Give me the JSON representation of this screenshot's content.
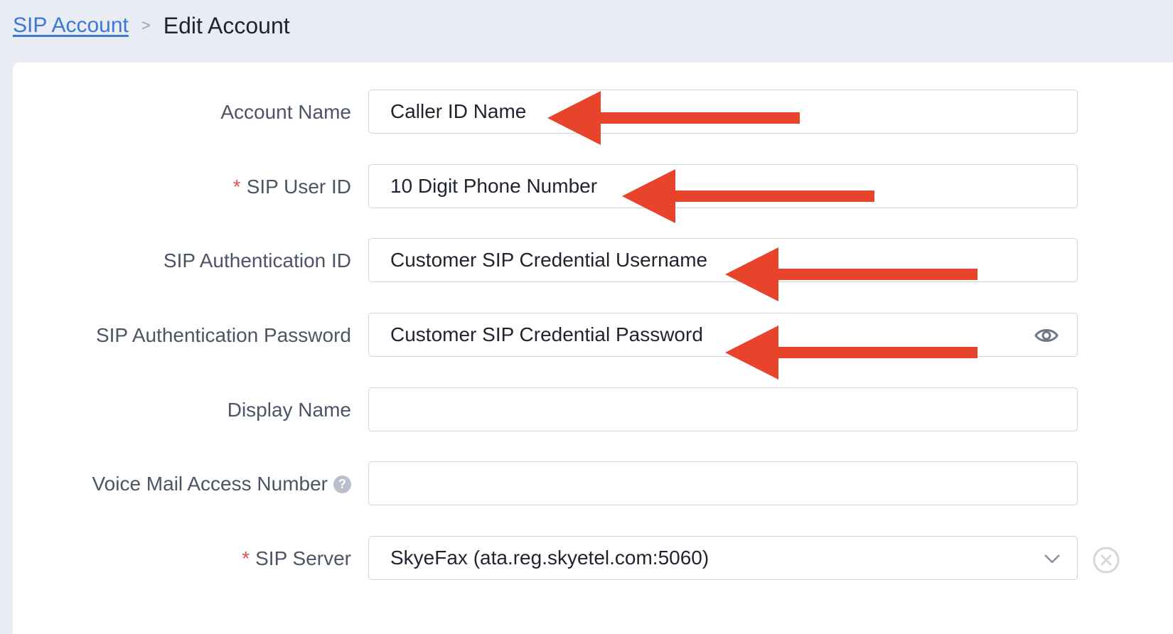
{
  "breadcrumb": {
    "parent": "SIP Account",
    "separator": ">",
    "current": "Edit Account"
  },
  "form": {
    "account_name": {
      "label": "Account Name",
      "value": "Caller ID Name"
    },
    "sip_user_id": {
      "required_mark": "*",
      "label": "SIP User ID",
      "value": "10 Digit Phone Number"
    },
    "sip_auth_id": {
      "label": "SIP Authentication ID",
      "value": "Customer SIP Credential Username"
    },
    "sip_auth_password": {
      "label": "SIP Authentication Password",
      "value": "Customer SIP Credential Password"
    },
    "display_name": {
      "label": "Display Name",
      "value": ""
    },
    "voice_mail_access_number": {
      "label": "Voice Mail Access Number",
      "help_icon": "question-mark-icon",
      "help_glyph": "?",
      "value": ""
    },
    "sip_server": {
      "required_mark": "*",
      "label": "SIP Server",
      "selected": "SkyeFax (ata.reg.skyetel.com:5060)"
    }
  },
  "icons": {
    "password_toggle": "eye-icon",
    "select_chevron": "chevron-down-icon",
    "clear": "close-circle-icon",
    "annotation": "arrow-left-icon"
  },
  "colors": {
    "page_background": "#e9ecf2",
    "card_background": "#ffffff",
    "link": "#3b78d8",
    "required": "#e0544b",
    "annotation_arrow": "#e8432b",
    "field_border": "#cfd4dc"
  }
}
